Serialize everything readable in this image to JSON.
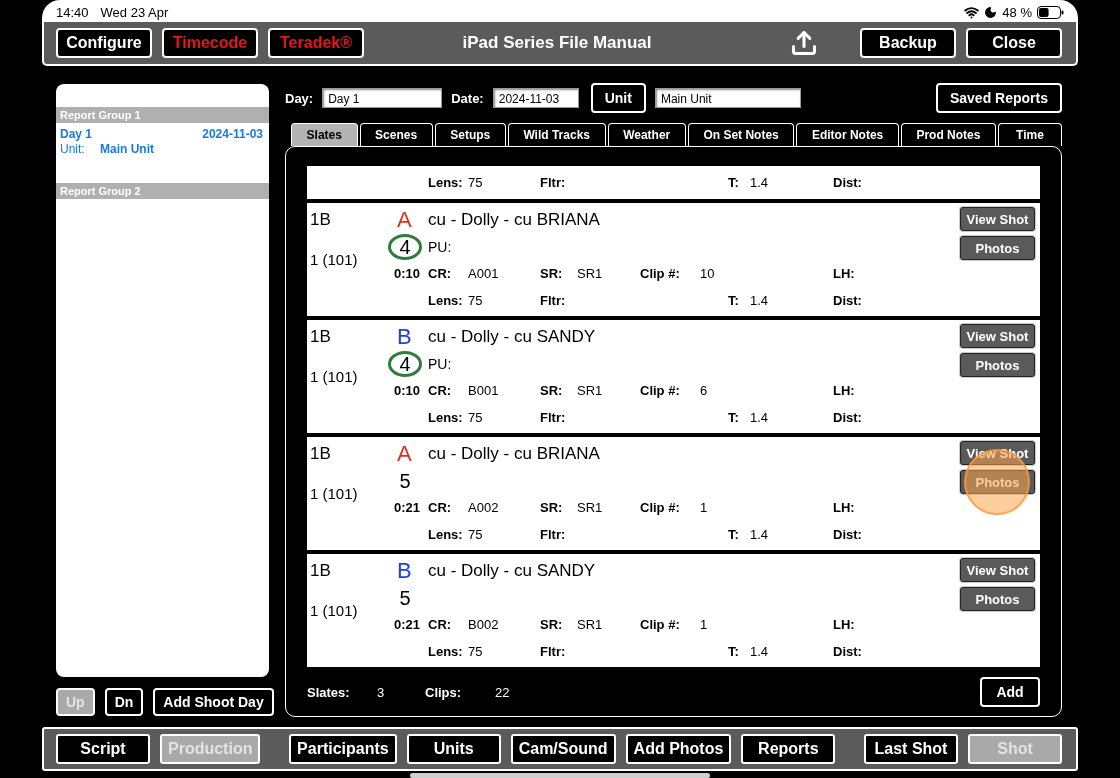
{
  "status_bar": {
    "time": "14:40",
    "date": "Wed 23 Apr",
    "battery": "48 %"
  },
  "toolbar": {
    "left_buttons": [
      {
        "label": "Configure",
        "kind": "normal"
      },
      {
        "label": "Timecode",
        "kind": "alert"
      },
      {
        "label": "Teradek®",
        "kind": "alert"
      }
    ],
    "title": "iPad Series File Manual",
    "right_buttons": [
      "Backup",
      "Close"
    ]
  },
  "report_groups": [
    {
      "title": "Report Group 1",
      "entries": [
        {
          "day": "Day 1",
          "date": "2024-11-03",
          "unit_label": "Unit:",
          "unit": "Main Unit"
        }
      ]
    },
    {
      "title": "Report Group 2"
    }
  ],
  "sidebar_buttons": [
    {
      "label": "Up",
      "disabled": true
    },
    {
      "label": "Dn",
      "disabled": false
    },
    {
      "label": "Add Shoot Day",
      "disabled": false
    }
  ],
  "header": {
    "day_label": "Day:",
    "day": "Day 1",
    "date_label": "Date:",
    "date": "2024-11-03",
    "unit_button": "Unit",
    "unit": "Main Unit",
    "saved_reports": "Saved Reports"
  },
  "tabs": [
    {
      "label": "Slates",
      "selected": true
    },
    {
      "label": "Scenes",
      "selected": false
    },
    {
      "label": "Setups",
      "selected": false
    },
    {
      "label": "Wild Tracks",
      "selected": false
    },
    {
      "label": "Weather",
      "selected": false
    },
    {
      "label": "On Set Notes",
      "selected": false
    },
    {
      "label": "Editor Notes",
      "selected": false
    },
    {
      "label": "Prod Notes",
      "selected": false
    },
    {
      "label": "Time",
      "selected": false
    }
  ],
  "partial_row": {
    "lens": {
      "label": "Lens:",
      "value": "75"
    },
    "filter": {
      "label": "Fltr:"
    },
    "stop": {
      "label": "T:",
      "value": "1.4"
    },
    "dist": {
      "label": "Dist:"
    }
  },
  "rows": [
    {
      "slate": "1B",
      "setup": "1 (101)",
      "camera": "A",
      "color": "#e0301e",
      "description": "cu - Dolly - cu BRIANA",
      "take": "4",
      "circled": true,
      "pu": "PU:",
      "duration": "0:10",
      "camera_roll": {
        "label": "CR:",
        "value": "A001"
      },
      "sound_roll": {
        "label": "SR:",
        "value": "SR1"
      },
      "clip": {
        "label": "Clip #:",
        "value": "10"
      },
      "lh": {
        "label": "LH:"
      },
      "lens": {
        "label": "Lens:",
        "value": "75"
      },
      "filter": {
        "label": "Fltr:"
      },
      "stop": {
        "label": "T:",
        "value": "1.4"
      },
      "dist": {
        "label": "Dist:"
      },
      "buttons": [
        "View Shot",
        "Photos"
      ],
      "touch_indicator": false
    },
    {
      "slate": "1B",
      "setup": "1 (101)",
      "camera": "B",
      "color": "#1f3fe0",
      "description": "cu - Dolly - cu SANDY",
      "take": "4",
      "circled": true,
      "pu": "PU:",
      "duration": "0:10",
      "camera_roll": {
        "label": "CR:",
        "value": "B001"
      },
      "sound_roll": {
        "label": "SR:",
        "value": "SR1"
      },
      "clip": {
        "label": "Clip #:",
        "value": "6"
      },
      "lh": {
        "label": "LH:"
      },
      "lens": {
        "label": "Lens:",
        "value": "75"
      },
      "filter": {
        "label": "Fltr:"
      },
      "stop": {
        "label": "T:",
        "value": "1.4"
      },
      "dist": {
        "label": "Dist:"
      },
      "buttons": [
        "View Shot",
        "Photos"
      ],
      "touch_indicator": false
    },
    {
      "slate": "1B",
      "setup": "1 (101)",
      "camera": "A",
      "color": "#e0301e",
      "description": "cu - Dolly - cu BRIANA",
      "take": "5",
      "circled": false,
      "duration": "0:21",
      "camera_roll": {
        "label": "CR:",
        "value": "A002"
      },
      "sound_roll": {
        "label": "SR:",
        "value": "SR1"
      },
      "clip": {
        "label": "Clip #:",
        "value": "1"
      },
      "lh": {
        "label": "LH:"
      },
      "lens": {
        "label": "Lens:",
        "value": "75"
      },
      "filter": {
        "label": "Fltr:"
      },
      "stop": {
        "label": "T:",
        "value": "1.4"
      },
      "dist": {
        "label": "Dist:"
      },
      "buttons": [
        "View Shot",
        "Photos"
      ],
      "touch_indicator": true
    },
    {
      "slate": "1B",
      "setup": "1 (101)",
      "camera": "B",
      "color": "#1f3fe0",
      "description": "cu - Dolly - cu SANDY",
      "take": "5",
      "circled": false,
      "duration": "0:21",
      "camera_roll": {
        "label": "CR:",
        "value": "B002"
      },
      "sound_roll": {
        "label": "SR:",
        "value": "SR1"
      },
      "clip": {
        "label": "Clip #:",
        "value": "1"
      },
      "lh": {
        "label": "LH:"
      },
      "lens": {
        "label": "Lens:",
        "value": "75"
      },
      "filter": {
        "label": "Fltr:"
      },
      "stop": {
        "label": "T:",
        "value": "1.4"
      },
      "dist": {
        "label": "Dist:"
      },
      "buttons": [
        "View Shot",
        "Photos"
      ],
      "touch_indicator": false
    }
  ],
  "footer": {
    "slates_label": "Slates:",
    "slates": "3",
    "clips_label": "Clips:",
    "clips": "22",
    "add": "Add"
  },
  "bottom_toolbar": {
    "left": [
      {
        "label": "Script",
        "disabled": false
      },
      {
        "label": "Production",
        "disabled": true
      }
    ],
    "middle": [
      {
        "label": "Participants",
        "disabled": false
      },
      {
        "label": "Units",
        "disabled": false
      },
      {
        "label": "Cam/Sound",
        "disabled": false
      },
      {
        "label": "Add Photos",
        "disabled": false
      },
      {
        "label": "Reports",
        "disabled": false
      }
    ],
    "right": [
      {
        "label": "Last Shot",
        "disabled": false
      },
      {
        "label": "Shot",
        "disabled": true
      }
    ]
  }
}
